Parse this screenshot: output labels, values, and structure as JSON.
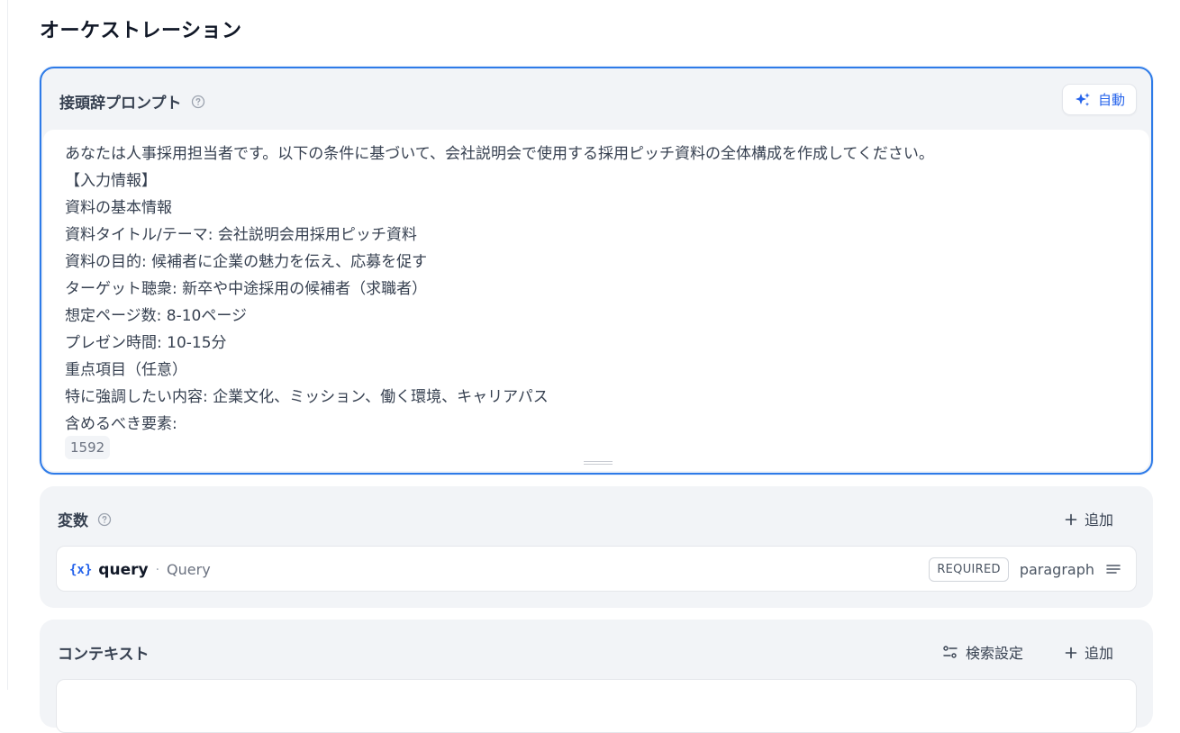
{
  "page": {
    "title": "オーケストレーション"
  },
  "prompt": {
    "label": "接頭辞プロンプト",
    "auto_button_label": "自動",
    "text": "あなたは人事採用担当者です。以下の条件に基づいて、会社説明会で使用する採用ピッチ資料の全体構成を作成してください。\n【入力情報】\n資料の基本情報\n資料タイトル/テーマ: 会社説明会用採用ピッチ資料\n資料の目的: 候補者に企業の魅力を伝え、応募を促す\nターゲット聴衆: 新卒や中途採用の候補者（求職者）\n想定ページ数: 8-10ページ\nプレゼン時間: 10-15分\n重点項目（任意）\n特に強調したい内容: 企業文化、ミッション、働く環境、キャリアパス\n含めるべき要素:",
    "char_count": "1592"
  },
  "variables": {
    "label": "変数",
    "add_label": "追加",
    "items": [
      {
        "icon_text": "{x}",
        "key": "query",
        "separator": "·",
        "name": "Query",
        "badge": "REQUIRED",
        "type": "paragraph"
      }
    ]
  },
  "context": {
    "label": "コンテキスト",
    "search_settings_label": "検索設定",
    "add_label": "追加"
  },
  "colors": {
    "accent": "#2563eb",
    "focus_border": "#2e7be8",
    "panel_bg": "#f2f4f7"
  },
  "icons": {
    "help": "question-circle-icon",
    "sparkle": "sparkle-icon",
    "plus": "plus-icon",
    "variable": "variable-braces-icon",
    "paragraph": "paragraph-lines-icon",
    "settings": "sliders-icon"
  }
}
